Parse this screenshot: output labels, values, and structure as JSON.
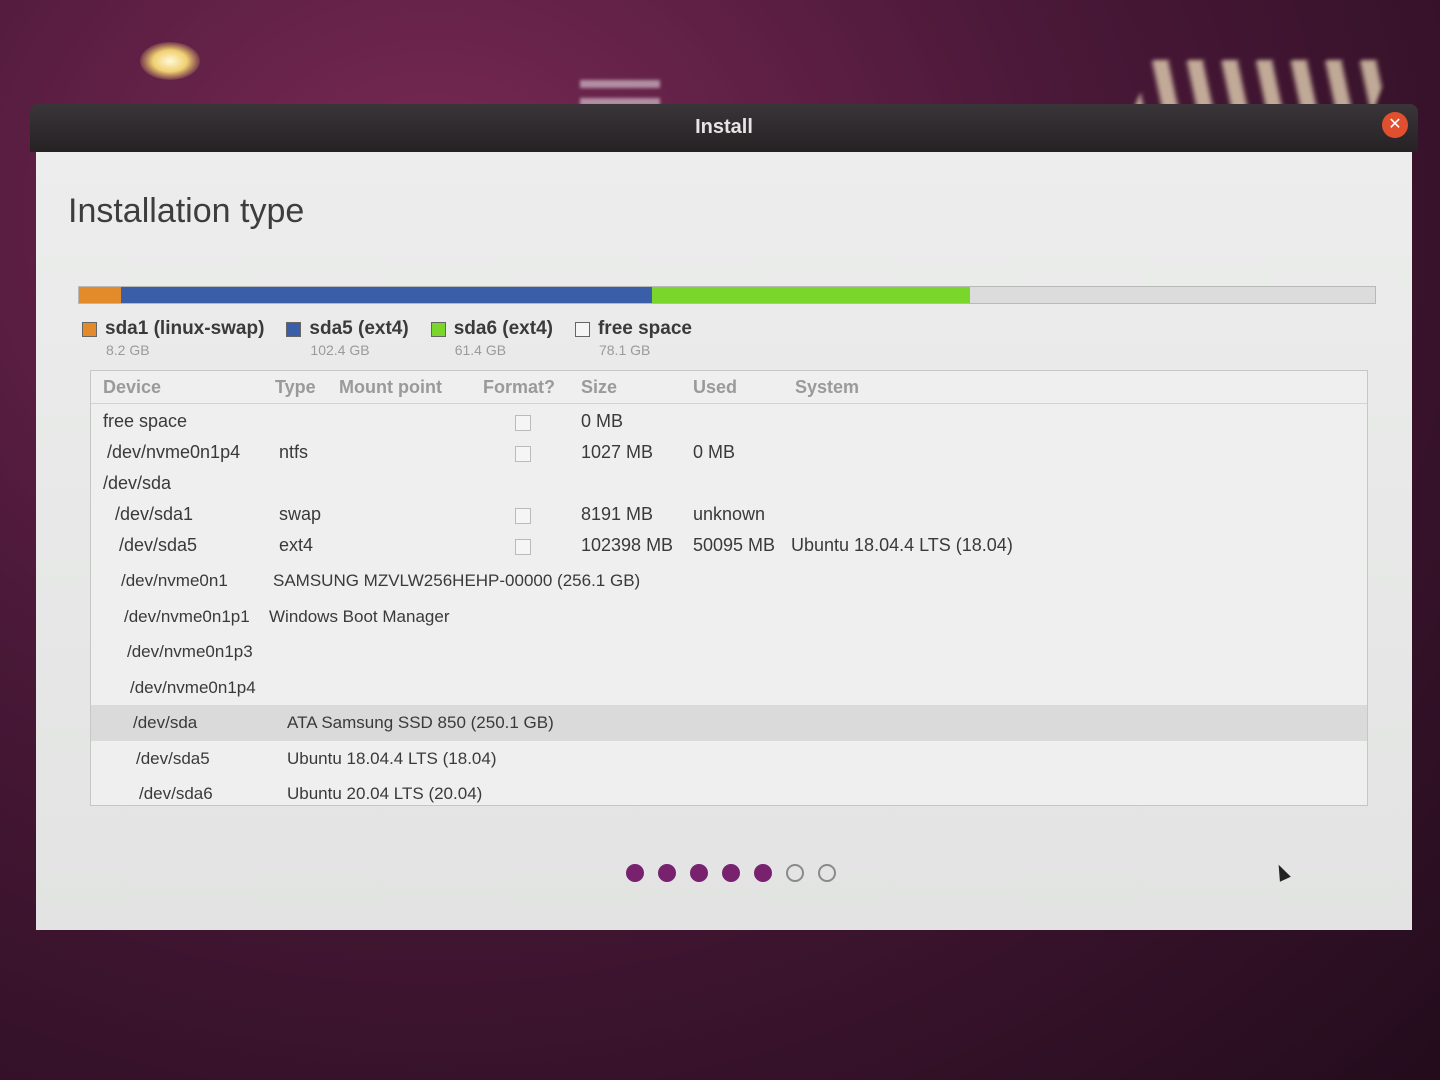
{
  "window": {
    "title": "Install"
  },
  "page_title": "Installation type",
  "partition_bar": [
    {
      "name": "sda1",
      "size_gb": 8.2,
      "color": "#e38a2a"
    },
    {
      "name": "sda5",
      "size_gb": 102.4,
      "color": "#3a5ea8"
    },
    {
      "name": "sda6",
      "size_gb": 61.4,
      "color": "#7ad62a"
    },
    {
      "name": "free",
      "size_gb": 78.1,
      "color": "#dcdcdc"
    }
  ],
  "legend": [
    {
      "label": "sda1 (linux-swap)",
      "size": "8.2 GB",
      "color": "#e38a2a"
    },
    {
      "label": "sda5 (ext4)",
      "size": "102.4 GB",
      "color": "#3a5ea8"
    },
    {
      "label": "sda6 (ext4)",
      "size": "61.4 GB",
      "color": "#7ad62a"
    },
    {
      "label": "free space",
      "size": "78.1 GB",
      "color": "#f5f5f5"
    }
  ],
  "table": {
    "headers": {
      "device": "Device",
      "type": "Type",
      "mount": "Mount point",
      "format": "Format?",
      "size": "Size",
      "used": "Used",
      "system": "System"
    },
    "rows": [
      {
        "device": "free space",
        "type": "",
        "size": "0 MB",
        "used": "",
        "system": "",
        "checkbox": true
      },
      {
        "device": "/dev/nvme0n1p4",
        "type": "ntfs",
        "size": "1027 MB",
        "used": "0 MB",
        "system": "",
        "checkbox": true
      },
      {
        "device": "/dev/sda",
        "type": "",
        "size": "",
        "used": "",
        "system": "",
        "checkbox": false
      },
      {
        "device": "/dev/sda1",
        "type": "swap",
        "size": "8191 MB",
        "used": "unknown",
        "system": "",
        "checkbox": true
      },
      {
        "device": "/dev/sda5",
        "type": "ext4",
        "size": "102398 MB",
        "used": "50095 MB",
        "system": "Ubuntu 18.04.4 LTS (18.04)",
        "checkbox": true
      }
    ]
  },
  "devices": [
    {
      "name": "/dev/nvme0n1",
      "desc": "SAMSUNG MZVLW256HEHP-00000 (256.1 GB)"
    },
    {
      "name": "/dev/nvme0n1p1",
      "desc": "Windows Boot Manager"
    },
    {
      "name": "/dev/nvme0n1p3",
      "desc": ""
    },
    {
      "name": "/dev/nvme0n1p4",
      "desc": ""
    },
    {
      "name": "/dev/sda",
      "desc": "ATA Samsung SSD 850 (250.1 GB)",
      "selected": true
    },
    {
      "name": "/dev/sda5",
      "desc": "Ubuntu 18.04.4 LTS (18.04)"
    },
    {
      "name": "/dev/sda6",
      "desc": "Ubuntu 20.04 LTS (20.04)"
    }
  ],
  "progress": {
    "current_step": 5,
    "total_steps": 7
  }
}
